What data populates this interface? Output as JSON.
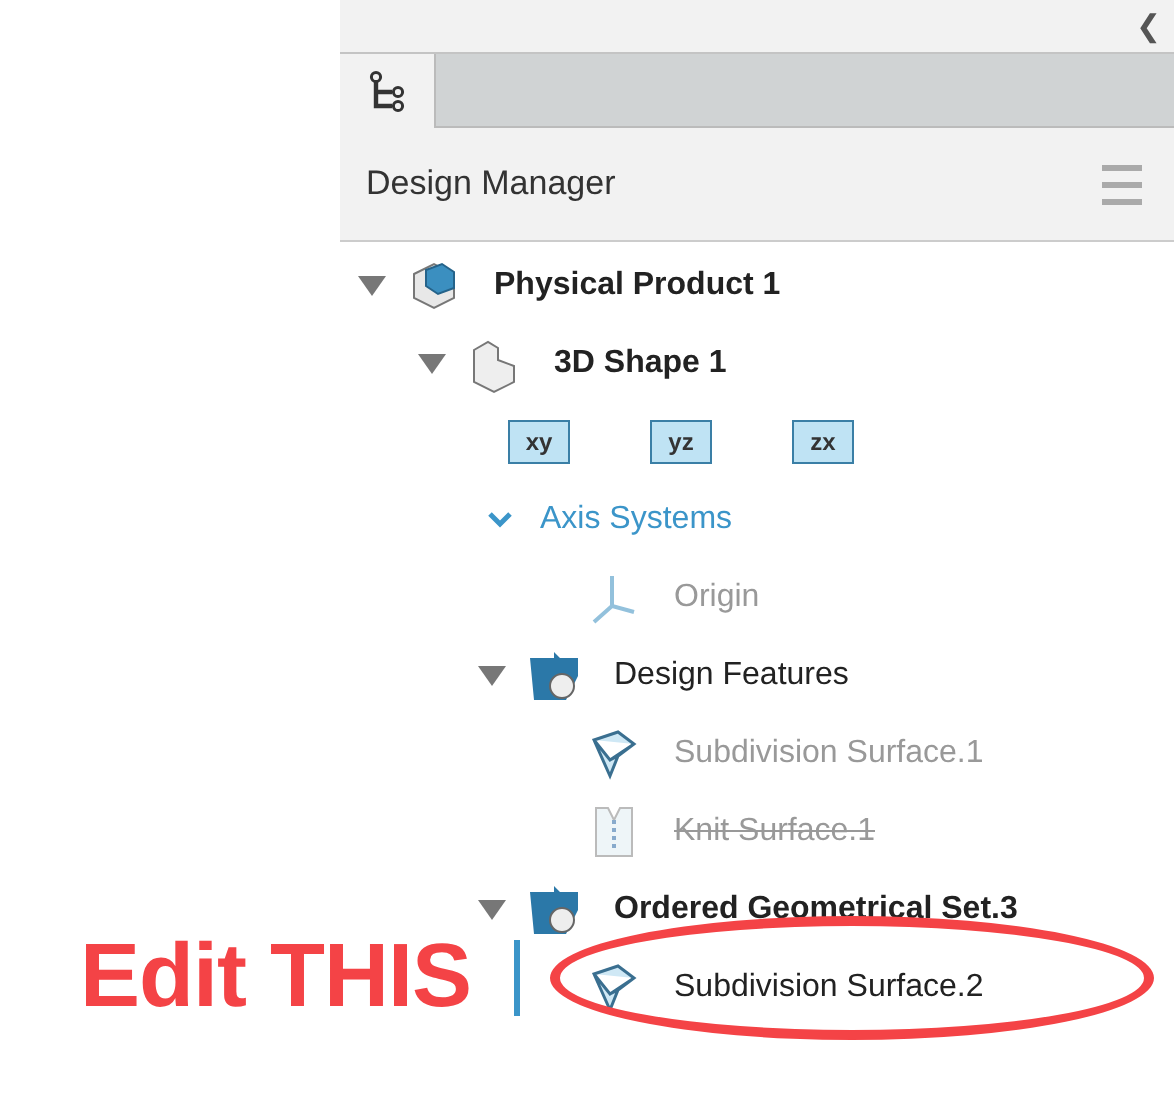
{
  "panel": {
    "collapse_glyph": "❮",
    "tabs": [
      {
        "selected": true
      }
    ],
    "title": "Design Manager"
  },
  "tree": [
    {
      "label": "Physical Product 1",
      "kind": "product",
      "bold": true,
      "expanded": true,
      "children": [
        {
          "label": "3D Shape 1",
          "kind": "shape",
          "bold": true,
          "expanded": true,
          "children": [
            {
              "kind": "planes",
              "planes": [
                "xy",
                "yz",
                "zx"
              ]
            },
            {
              "label": "Axis Systems",
              "kind": "folder",
              "expanded": true,
              "children": [
                {
                  "label": "Origin",
                  "kind": "axis",
                  "hidden": true
                }
              ]
            },
            {
              "label": "Design Features",
              "kind": "geoset",
              "expanded": true,
              "children": [
                {
                  "label": "Subdivision Surface.1",
                  "kind": "subdivision",
                  "hidden": true
                },
                {
                  "label": "Knit Surface.1",
                  "kind": "knit",
                  "hidden": true,
                  "deactivated": true
                }
              ]
            },
            {
              "label": "Ordered Geometrical Set.3",
              "kind": "geoset",
              "bold": true,
              "expanded": true,
              "children": [
                {
                  "label": "Subdivision Surface.2",
                  "kind": "subdivision",
                  "circled": true
                }
              ]
            }
          ]
        }
      ]
    }
  ],
  "annotation": {
    "text": "Edit THIS"
  }
}
